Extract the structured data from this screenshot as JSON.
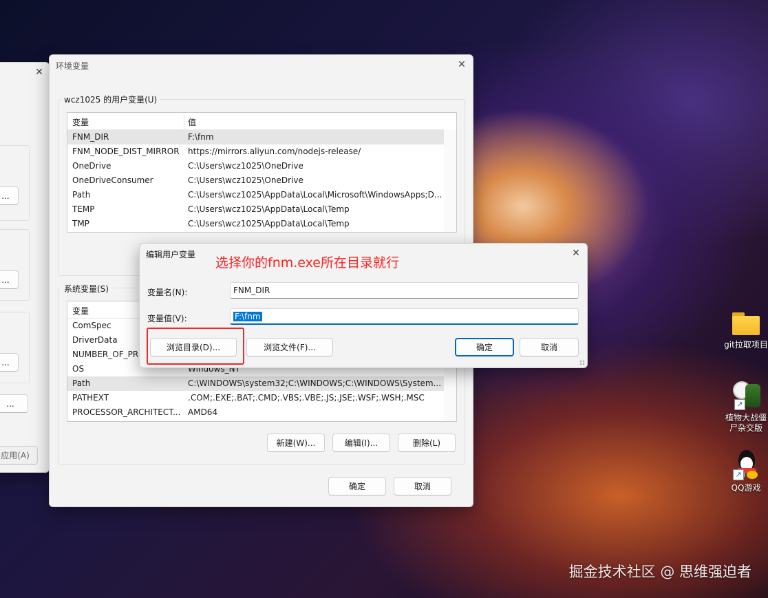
{
  "background_window": {
    "apply_label": "应用(A)",
    "ellipsis": "..."
  },
  "env_window": {
    "title": "环境变量",
    "user_group_label": "wcz1025 的用户变量(U)",
    "col_var": "变量",
    "col_val": "值",
    "user_vars": [
      {
        "name": "FNM_DIR",
        "value": "F:\\fnm"
      },
      {
        "name": "FNM_NODE_DIST_MIRROR",
        "value": "https://mirrors.aliyun.com/nodejs-release/"
      },
      {
        "name": "OneDrive",
        "value": "C:\\Users\\wcz1025\\OneDrive"
      },
      {
        "name": "OneDriveConsumer",
        "value": "C:\\Users\\wcz1025\\OneDrive"
      },
      {
        "name": "Path",
        "value": "C:\\Users\\wcz1025\\AppData\\Local\\Microsoft\\WindowsApps;D..."
      },
      {
        "name": "TEMP",
        "value": "C:\\Users\\wcz1025\\AppData\\Local\\Temp"
      },
      {
        "name": "TMP",
        "value": "C:\\Users\\wcz1025\\AppData\\Local\\Temp"
      }
    ],
    "system_group_label": "系统变量(S)",
    "system_vars": [
      {
        "name": "ComSpec",
        "value": ""
      },
      {
        "name": "DriverData",
        "value": ""
      },
      {
        "name": "NUMBER_OF_PRO",
        "value": ""
      },
      {
        "name": "OS",
        "value": "Windows_NT"
      },
      {
        "name": "Path",
        "value": "C:\\WINDOWS\\system32;C:\\WINDOWS;C:\\WINDOWS\\System..."
      },
      {
        "name": "PATHEXT",
        "value": ".COM;.EXE;.BAT;.CMD;.VBS;.VBE;.JS;.JSE;.WSF;.WSH;.MSC"
      },
      {
        "name": "PROCESSOR_ARCHITECT...",
        "value": "AMD64"
      }
    ],
    "new_label": "新建(W)...",
    "edit_label": "编辑(I)...",
    "delete_label": "删除(L)",
    "ok_label": "确定",
    "cancel_label": "取消"
  },
  "edit_dialog": {
    "title": "编辑用户变量",
    "name_label": "变量名(N):",
    "name_value": "FNM_DIR",
    "value_label": "变量值(V):",
    "value_value": "F:\\fnm",
    "browse_dir_label": "浏览目录(D)...",
    "browse_file_label": "浏览文件(F)...",
    "ok_label": "确定",
    "cancel_label": "取消"
  },
  "annotation_text": "选择你的fnm.exe所在目录就行",
  "desktop_icons": [
    {
      "label": "git拉取项目",
      "icon": "folder-icon"
    },
    {
      "label": "植物大战僵尸杂交版",
      "icon": "plant-game-icon"
    },
    {
      "label": "QQ游戏",
      "icon": "qq-penguin-icon"
    }
  ],
  "watermark": "掘金技术社区 @ 思维强迫者",
  "colors": {
    "accent": "#0067c0",
    "annotation": "#ff2020"
  }
}
